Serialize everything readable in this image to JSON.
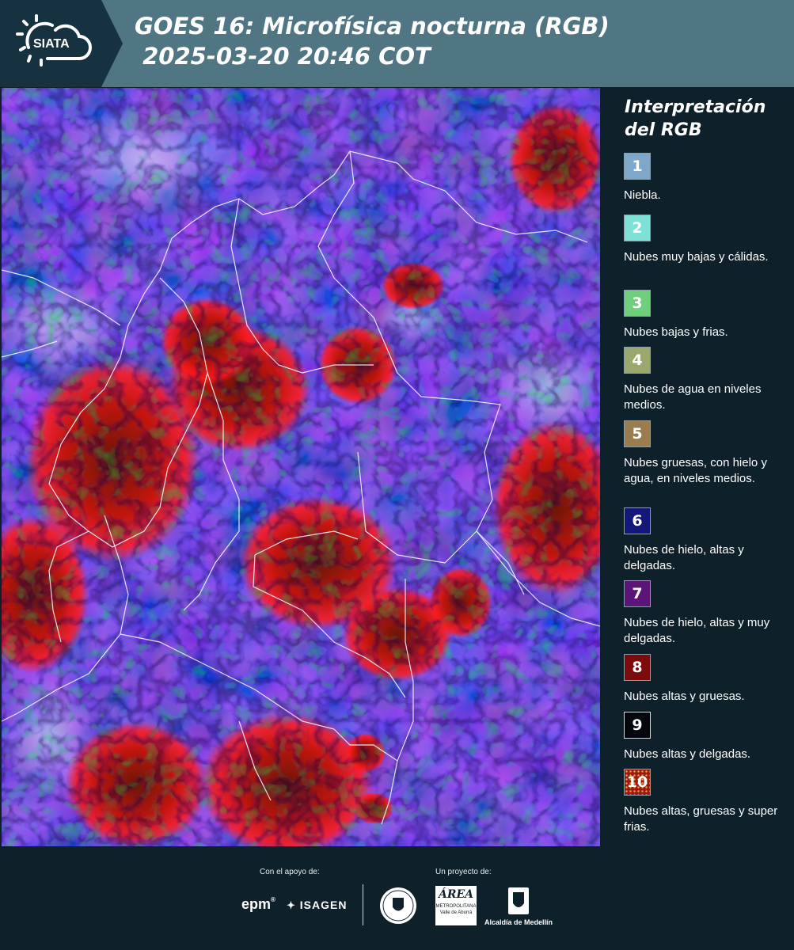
{
  "header": {
    "logo_text": "SIATA",
    "title_line1": "GOES 16: Microfísica nocturna (RGB)",
    "title_line2": " 2025-03-20 20:46 COT"
  },
  "legend": {
    "title_line1": "Interpretación",
    "title_line2": "del RGB",
    "items": [
      {
        "number": "1",
        "label": "Niebla.",
        "color": "#7fa7c9"
      },
      {
        "number": "2",
        "label": "Nubes muy bajas y cálidas.",
        "color": "#7ee1d6"
      },
      {
        "number": "3",
        "label": "Nubes bajas y frias.",
        "color": "#6fcf7a"
      },
      {
        "number": "4",
        "label": "Nubes de agua en niveles medios.",
        "color": "#9aa86b"
      },
      {
        "number": "5",
        "label": "Nubes gruesas, con hielo y agua, en niveles medios.",
        "color": "#9a7c4f"
      },
      {
        "number": "6",
        "label": "Nubes de hielo, altas y delgadas.",
        "color": "#15167a"
      },
      {
        "number": "7",
        "label": "Nubes de hielo, altas y muy delgadas.",
        "color": "#5d1478"
      },
      {
        "number": "8",
        "label": "Nubes altas y gruesas.",
        "color": "#7e0b0b"
      },
      {
        "number": "9",
        "label": "Nubes altas y delgadas.",
        "color": "#05070d"
      },
      {
        "number": "10",
        "label": "Nubes altas, gruesas y super frias.",
        "color": "#9b1a10"
      }
    ]
  },
  "footer": {
    "support_label": "Con el apoyo de:",
    "project_label": "Un proyecto de:",
    "sponsor1": "epm",
    "sponsor2": "ISAGEN",
    "partner1_line1": "ÁREA",
    "partner1_line2": "METROPOLITANA",
    "partner1_line3": "Valle de Aburrá",
    "partner2": "Alcaldía de Medellín"
  }
}
